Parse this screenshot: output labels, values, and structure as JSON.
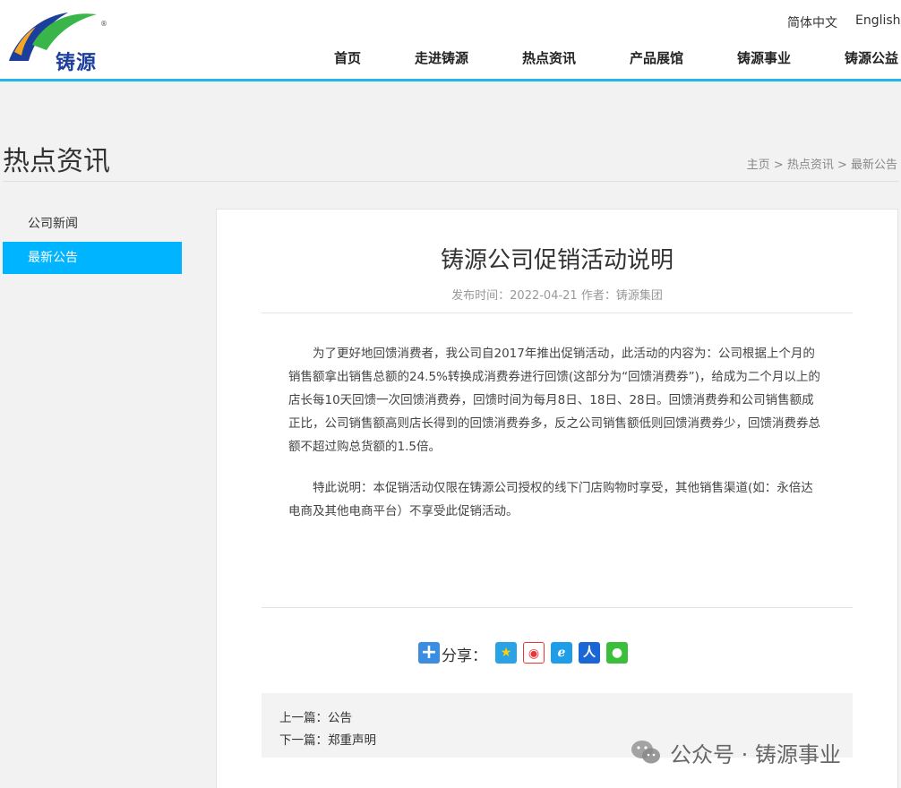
{
  "header": {
    "logo_text": "铸源",
    "logo_registered": "®",
    "lang_cn": "简体中文",
    "lang_en": "English",
    "nav": [
      "首页",
      "走进铸源",
      "热点资讯",
      "产品展馆",
      "铸源事业",
      "铸源公益"
    ]
  },
  "page": {
    "section_title": "热点资讯",
    "breadcrumb": "主页 > 热点资讯 > 最新公告"
  },
  "sidebar": {
    "items": [
      "公司新闻",
      "最新公告"
    ],
    "active_index": 1
  },
  "article": {
    "title": "铸源公司促销活动说明",
    "meta": "发布时间：2022-04-21  作者：铸源集团",
    "paragraph1": "为了更好地回馈消费者，我公司自2017年推出促销活动，此活动的内容为：公司根据上个月的销售额拿出销售总额的24.5%转换成消费券进行回馈(这部分为“回馈消费券”)，给成为二个月以上的店长每10天回馈一次回馈消费券，回馈时间为每月8日、18日、28日。回馈消费券和公司销售额成正比，公司销售额高则店长得到的回馈消费券多，反之公司销售额低则回馈消费券少，回馈消费券总额不超过购总货额的1.5倍。",
    "paragraph2": "特此说明：本促销活动仅限在铸源公司授权的线下门店购物时享受，其他销售渠道(如：永倍达电商及其他电商平台）不享受此促销活动。"
  },
  "share": {
    "label": "分享：",
    "icons": [
      "qzone-icon",
      "weibo-icon",
      "tencent-weibo-icon",
      "renren-icon",
      "wechat-icon"
    ]
  },
  "prevnext": {
    "prev": "上一篇：公告",
    "next": "下一篇：郑重声明"
  },
  "watermark": {
    "text": "公众号 · 铸源事业"
  },
  "colors": {
    "accent": "#23b7e5",
    "sidebar_active": "#00b4ff",
    "logo_blue": "#1c3f9b",
    "logo_green": "#3ab54a"
  }
}
